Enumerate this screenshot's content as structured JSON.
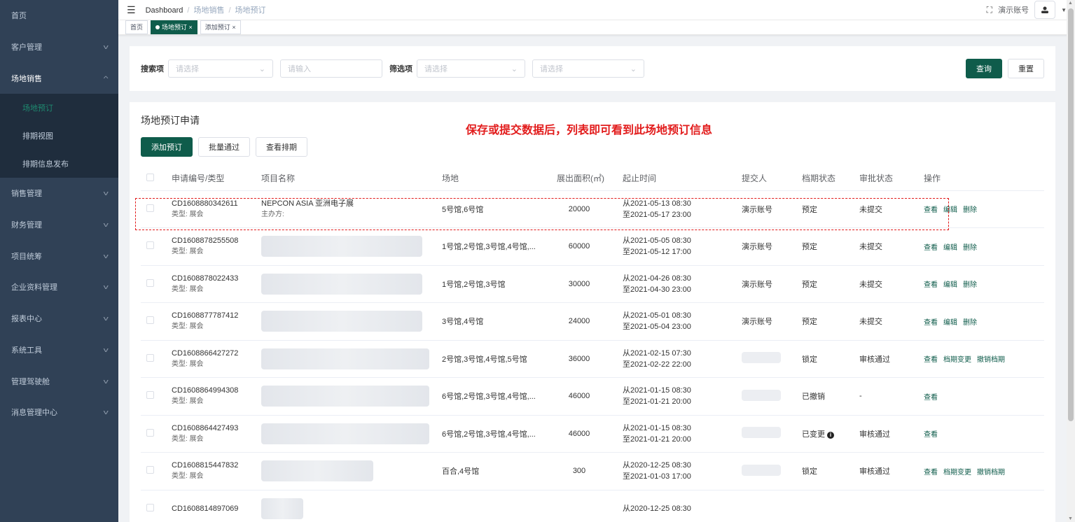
{
  "sidebar": {
    "items": [
      {
        "label": "首页",
        "expandable": false
      },
      {
        "label": "客户管理",
        "expandable": true
      },
      {
        "label": "场地销售",
        "expandable": true,
        "open": true
      },
      {
        "label": "销售管理",
        "expandable": true
      },
      {
        "label": "财务管理",
        "expandable": true
      },
      {
        "label": "项目统筹",
        "expandable": true
      },
      {
        "label": "企业资料管理",
        "expandable": true
      },
      {
        "label": "报表中心",
        "expandable": true
      },
      {
        "label": "系统工具",
        "expandable": true
      },
      {
        "label": "管理驾驶舱",
        "expandable": true
      },
      {
        "label": "消息管理中心",
        "expandable": true
      }
    ],
    "subitems": [
      {
        "label": "场地预订",
        "active": true
      },
      {
        "label": "排期视图"
      },
      {
        "label": "排期信息发布"
      }
    ]
  },
  "header": {
    "breadcrumb": [
      "Dashboard",
      "场地销售",
      "场地预订"
    ],
    "account": "演示账号"
  },
  "tabs": [
    {
      "label": "首页"
    },
    {
      "label": "场地预订",
      "active": true
    },
    {
      "label": "添加预订"
    }
  ],
  "filter": {
    "search_label": "搜索项",
    "search_select_placeholder": "请选择",
    "search_input_placeholder": "请输入",
    "filter_label": "筛选项",
    "filter_select1_placeholder": "请选择",
    "filter_select2_placeholder": "请选择",
    "query_button": "查询",
    "reset_button": "重置"
  },
  "panel": {
    "title": "场地预订申请",
    "notice": "保存或提交数据后，列表即可看到此场地预订信息",
    "add_button": "添加预订",
    "batch_button": "批量通过",
    "schedule_button": "查看排期"
  },
  "table": {
    "headers": [
      "申请编号/类型",
      "项目名称",
      "场地",
      "展出面积(㎡)",
      "起止时间",
      "提交人",
      "档期状态",
      "审批状态",
      "操作"
    ],
    "rows": [
      {
        "id": "CD1608880342611",
        "type": "类型: 展会",
        "name": "NEPCON ASIA 亚洲电子展",
        "name_sub": "主办方:",
        "venue": "5号馆,6号馆",
        "area": "20000",
        "from": "从2021-05-13 08:30",
        "to": "至2021-05-17 23:00",
        "submitter": "演示账号",
        "schedule_status": "预定",
        "approval_status": "未提交",
        "actions": [
          "查看",
          "编辑",
          "删除"
        ]
      },
      {
        "id": "CD1608878255508",
        "type": "类型: 展会",
        "name": "",
        "name_sub": "",
        "venue": "1号馆,2号馆,3号馆,4号馆,...",
        "area": "60000",
        "from": "从2021-05-05 08:30",
        "to": "至2021-05-12 17:00",
        "submitter": "演示账号",
        "schedule_status": "预定",
        "approval_status": "未提交",
        "actions": [
          "查看",
          "编辑",
          "删除"
        ]
      },
      {
        "id": "CD1608878022433",
        "type": "类型: 展会",
        "name": "",
        "name_sub": "",
        "venue": "1号馆,2号馆,3号馆",
        "area": "30000",
        "from": "从2021-04-26 08:30",
        "to": "至2021-04-30 23:00",
        "submitter": "演示账号",
        "schedule_status": "预定",
        "approval_status": "未提交",
        "actions": [
          "查看",
          "编辑",
          "删除"
        ]
      },
      {
        "id": "CD1608877787412",
        "type": "类型: 展会",
        "name": "",
        "name_sub": "",
        "venue": "3号馆,4号馆",
        "area": "24000",
        "from": "从2021-05-01 08:30",
        "to": "至2021-05-04 23:00",
        "submitter": "演示账号",
        "schedule_status": "预定",
        "approval_status": "未提交",
        "actions": [
          "查看",
          "编辑",
          "删除"
        ]
      },
      {
        "id": "CD1608866427272",
        "type": "类型: 展会",
        "name": "",
        "name_sub": "",
        "venue": "2号馆,3号馆,4号馆,5号馆",
        "area": "36000",
        "from": "从2021-02-15 07:30",
        "to": "至2021-02-22 22:00",
        "submitter": "",
        "schedule_status": "锁定",
        "approval_status": "审核通过",
        "actions": [
          "查看",
          "档期变更",
          "撤销档期"
        ]
      },
      {
        "id": "CD1608864994308",
        "type": "类型: 展会",
        "name": "",
        "name_sub": "",
        "venue": "6号馆,2号馆,3号馆,4号馆,...",
        "area": "46000",
        "from": "从2021-01-15 08:30",
        "to": "至2021-01-21 20:00",
        "submitter": "",
        "schedule_status": "已撤销",
        "approval_status": "-",
        "actions": [
          "查看"
        ]
      },
      {
        "id": "CD1608864427493",
        "type": "类型: 展会",
        "name": "",
        "name_sub": "",
        "venue": "6号馆,2号馆,3号馆,4号馆,...",
        "area": "46000",
        "from": "从2021-01-15 08:30",
        "to": "至2021-01-21 20:00",
        "submitter": "",
        "schedule_status": "已变更",
        "approval_status": "审核通过",
        "actions": [
          "查看"
        ]
      },
      {
        "id": "CD1608815447832",
        "type": "类型: 展会",
        "name": "",
        "name_sub": "",
        "venue": "百合,4号馆",
        "area": "300",
        "from": "从2020-12-25 08:30",
        "to": "至2021-01-03 17:00",
        "submitter": "",
        "schedule_status": "锁定",
        "approval_status": "审核通过",
        "actions": [
          "查看",
          "档期变更",
          "撤销档期"
        ]
      },
      {
        "id": "CD1608814897069",
        "type": "",
        "name": "",
        "name_sub": "",
        "venue": "",
        "area": "",
        "from": "从2020-12-25 08:30",
        "to": "",
        "submitter": "",
        "schedule_status": "",
        "approval_status": "",
        "actions": []
      }
    ]
  }
}
